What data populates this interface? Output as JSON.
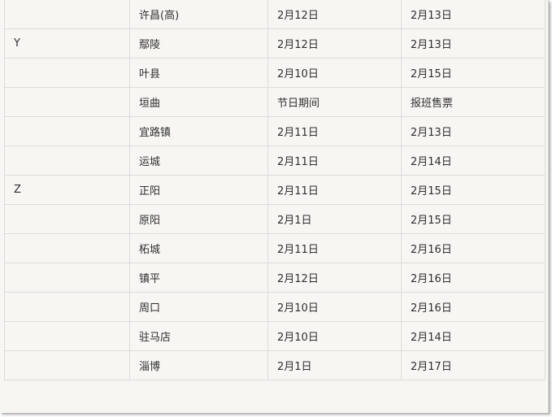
{
  "table": {
    "rows": [
      {
        "letter": "",
        "city": "许昌(高)",
        "start": "2月12日",
        "end": "2月13日"
      },
      {
        "letter": "Y",
        "city": "鄢陵",
        "start": "2月12日",
        "end": "2月13日"
      },
      {
        "letter": "",
        "city": "叶县",
        "start": "2月10日",
        "end": "2月15日"
      },
      {
        "letter": "",
        "city": "垣曲",
        "start": "节日期间",
        "end": "报班售票"
      },
      {
        "letter": "",
        "city": "宜路镇",
        "start": "2月11日",
        "end": "2月13日"
      },
      {
        "letter": "",
        "city": "运城",
        "start": "2月11日",
        "end": "2月14日"
      },
      {
        "letter": "Z",
        "city": "正阳",
        "start": "2月11日",
        "end": "2月15日"
      },
      {
        "letter": "",
        "city": "原阳",
        "start": "2月1日",
        "end": "2月15日"
      },
      {
        "letter": "",
        "city": "柘城",
        "start": "2月11日",
        "end": "2月16日"
      },
      {
        "letter": "",
        "city": "镇平",
        "start": "2月12日",
        "end": "2月16日"
      },
      {
        "letter": "",
        "city": "周口",
        "start": "2月10日",
        "end": "2月16日"
      },
      {
        "letter": "",
        "city": "驻马店",
        "start": "2月10日",
        "end": "2月14日"
      },
      {
        "letter": "",
        "city": "淄博",
        "start": "2月1日",
        "end": "2月17日"
      }
    ]
  }
}
